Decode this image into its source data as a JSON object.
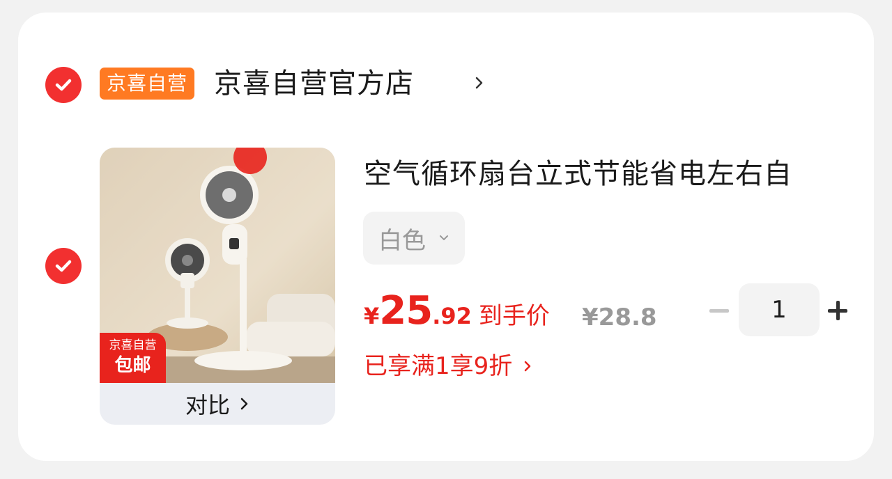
{
  "shop": {
    "checked": true,
    "badge": "京喜自营",
    "name": "京喜自营官方店"
  },
  "item": {
    "checked": true,
    "title": "空气循环扇台立式节能省电左右自",
    "thumbnail_tag_line1": "京喜自营",
    "thumbnail_tag_line2": "包邮",
    "compare_label": "对比",
    "spec_value": "白色",
    "price_currency": "¥",
    "price_integer": "25",
    "price_decimal": ".92",
    "price_label": "到手价",
    "original_price": "¥28.8",
    "promotion": "已享满1享9折",
    "quantity": "1"
  },
  "colors": {
    "accent_red": "#e8231d",
    "badge_orange": "#ff7a22",
    "muted_gray": "#999999"
  },
  "icons": [
    "check-circle-icon",
    "chevron-right-icon",
    "chevron-down-icon",
    "minus-icon",
    "plus-icon"
  ]
}
